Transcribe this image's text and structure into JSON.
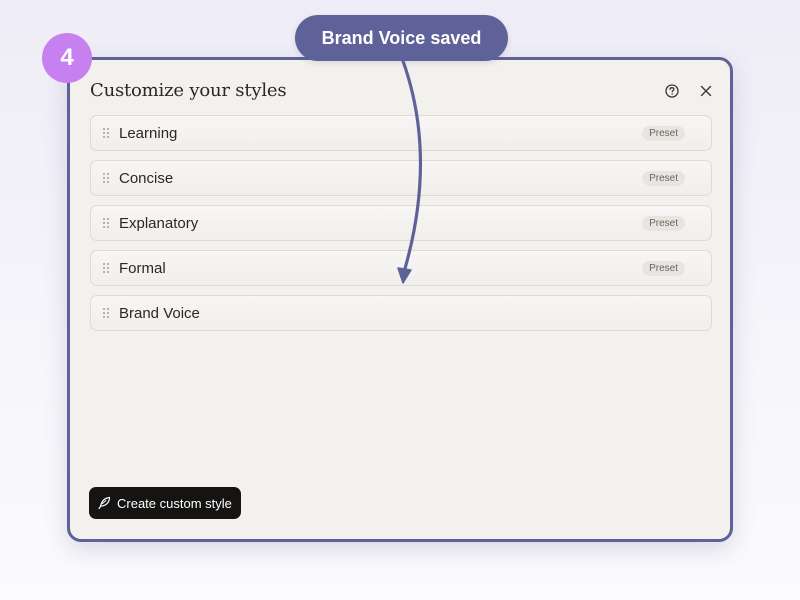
{
  "step": {
    "number": "4"
  },
  "callout": {
    "text": "Brand Voice saved"
  },
  "dialog": {
    "title": "Customize your styles",
    "help_icon": "help-circle-icon",
    "close_icon": "close-icon",
    "styles": [
      {
        "label": "Learning",
        "badge": "Preset"
      },
      {
        "label": "Concise",
        "badge": "Preset"
      },
      {
        "label": "Explanatory",
        "badge": "Preset"
      },
      {
        "label": "Formal",
        "badge": "Preset"
      },
      {
        "label": "Brand Voice",
        "badge": ""
      }
    ],
    "create_button": {
      "label": "Create custom style",
      "icon": "feather-icon"
    }
  },
  "colors": {
    "accent": "#5f6299",
    "badge": "#c680f0",
    "button": "#151413",
    "dialog_bg": "#f3f1ee"
  }
}
